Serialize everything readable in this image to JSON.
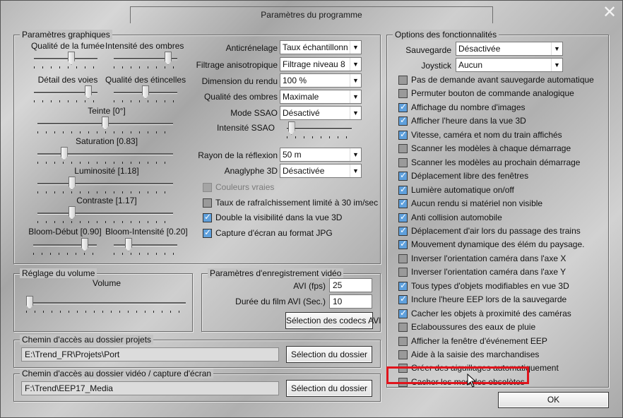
{
  "window": {
    "title": "Paramètres du programme",
    "close_glyph": "✕"
  },
  "graphics": {
    "title": "Paramètres graphiques",
    "sliders": [
      {
        "label": "Qualité de la fumée",
        "value": 0.6
      },
      {
        "label": "Intensité des ombres",
        "value": 0.9
      },
      {
        "label": "Détail des voies",
        "value": 0.9
      },
      {
        "label": "Qualité des étincelles",
        "value": 0.5
      },
      {
        "label": "Teinte [0°]",
        "value": 0.5
      },
      {
        "label": "Saturation [0.83]",
        "value": 0.18
      },
      {
        "label": "Luminosité [1.18]",
        "value": 0.24
      },
      {
        "label": "Contraste [1.17]",
        "value": 0.24
      },
      {
        "label": "Bloom-Début [0.90]",
        "value": 0.85
      },
      {
        "label": "Bloom-Intensité [0.20]",
        "value": 0.2
      }
    ],
    "combos": [
      {
        "label": "Anticrénelage",
        "value": "Taux échantillonnage"
      },
      {
        "label": "Filtrage anisotropique",
        "value": "Filtrage niveau 8"
      },
      {
        "label": "Dimension du rendu",
        "value": "100 %"
      },
      {
        "label": "Qualité des ombres",
        "value": "Maximale"
      },
      {
        "label": "Mode SSAO",
        "value": "Désactivé"
      }
    ],
    "ssao_intensity": {
      "label": "Intensité SSAO",
      "value": 0.02
    },
    "combos2": [
      {
        "label": "Rayon de la réflexion",
        "value": "50 m"
      },
      {
        "label": "Anaglyphe 3D",
        "value": "Désactivée"
      }
    ],
    "checks": [
      {
        "label": "Couleurs vraies",
        "state": "disabled"
      },
      {
        "label": "Taux de rafraîchissement limité à 30 im/sec",
        "state": "off"
      },
      {
        "label": "Double la visibilité dans la vue 3D",
        "state": "on"
      },
      {
        "label": "Capture d'écran au format JPG",
        "state": "on"
      }
    ]
  },
  "volume": {
    "title": "Réglage du volume",
    "label": "Volume",
    "value": 0.0
  },
  "video": {
    "title": "Paramètres d'enregistrement vidéo",
    "fps_label": "AVI (fps)",
    "fps_value": "25",
    "duration_label": "Durée du film AVI (Sec.)",
    "duration_value": "10",
    "codec_button": "Sélection des codecs AVI"
  },
  "projects": {
    "title": "Chemin d'accès au dossier projets",
    "path": "E:\\Trend_FR\\Projets\\Port",
    "button": "Sélection du dossier"
  },
  "video_path": {
    "title": "Chemin d'accès au dossier vidéo / capture d'écran",
    "path": "F:\\Trend\\EEP17_Media",
    "button": "Sélection du dossier"
  },
  "features": {
    "title": "Options des fonctionnalités",
    "save_label": "Sauvegarde",
    "save_value": "Désactivée",
    "joystick_label": "Joystick",
    "joystick_value": "Aucun",
    "checks": [
      {
        "label": "Pas de demande avant sauvegarde automatique",
        "state": "off"
      },
      {
        "label": "Permuter bouton de commande analogique",
        "state": "off"
      },
      {
        "label": "Affichage du nombre d'images",
        "state": "on"
      },
      {
        "label": "Afficher l'heure dans la vue 3D",
        "state": "on"
      },
      {
        "label": "Vitesse, caméra et nom du train affichés",
        "state": "on"
      },
      {
        "label": "Scanner les modèles à chaque démarrage",
        "state": "off"
      },
      {
        "label": "Scanner les modèles au prochain démarrage",
        "state": "off"
      },
      {
        "label": "Déplacement libre des fenêtres",
        "state": "on"
      },
      {
        "label": "Lumière automatique on/off",
        "state": "on"
      },
      {
        "label": "Aucun rendu si matériel non visible",
        "state": "on"
      },
      {
        "label": "Anti collision automobile",
        "state": "on"
      },
      {
        "label": "Déplacement d'air lors du passage des trains",
        "state": "on"
      },
      {
        "label": "Mouvement dynamique des élém du paysage.",
        "state": "on"
      },
      {
        "label": "Inverser l'orientation caméra dans l'axe X",
        "state": "off"
      },
      {
        "label": "Inverser l'orientation caméra dans l'axe Y",
        "state": "off"
      },
      {
        "label": "Tous types d'objets modifiables en vue 3D",
        "state": "on"
      },
      {
        "label": "Inclure l'heure EEP lors de la sauvegarde",
        "state": "on"
      },
      {
        "label": "Cacher les objets à proximité des caméras",
        "state": "on"
      },
      {
        "label": "Eclaboussures des eaux de pluie",
        "state": "off"
      },
      {
        "label": "Afficher la fenêtre d'événement EEP",
        "state": "off"
      },
      {
        "label": "Aide à la saisie des marchandises",
        "state": "off"
      },
      {
        "label": "Créer des aiguillages automatiquement",
        "state": "off"
      },
      {
        "label": "Cacher les modèles obsolètes",
        "state": "off"
      }
    ]
  },
  "ok_button": "OK",
  "colors": {
    "checked": "#5fa0dc",
    "highlight": "#e0141c"
  }
}
